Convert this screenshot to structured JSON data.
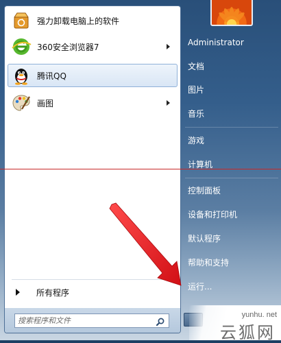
{
  "programs": [
    {
      "label": "强力卸载电脑上的软件",
      "icon": "uninstall-box-icon"
    },
    {
      "label": "360安全浏览器7",
      "icon": "browser-360-icon",
      "submenu": true
    },
    {
      "label": "腾讯QQ",
      "icon": "qq-penguin-icon",
      "selected": true
    },
    {
      "label": "画图",
      "icon": "paint-palette-icon",
      "submenu": true
    }
  ],
  "all_programs_label": "所有程序",
  "search": {
    "placeholder": "搜索程序和文件"
  },
  "right_items": [
    {
      "label": "Administrator"
    },
    {
      "label": "文档"
    },
    {
      "label": "图片"
    },
    {
      "label": "音乐"
    },
    {
      "label": "游戏"
    },
    {
      "label": "计算机"
    },
    {
      "label": "控制面板"
    },
    {
      "label": "设备和打印机"
    },
    {
      "label": "默认程序"
    },
    {
      "label": "帮助和支持"
    },
    {
      "label": "运行..."
    }
  ],
  "watermark": {
    "url": "yunhu. net",
    "text": "云狐网"
  },
  "colors": {
    "selected_highlight": "#d9e6f5",
    "red_guide_line": "#c72828",
    "arrow": "#e8171e"
  }
}
